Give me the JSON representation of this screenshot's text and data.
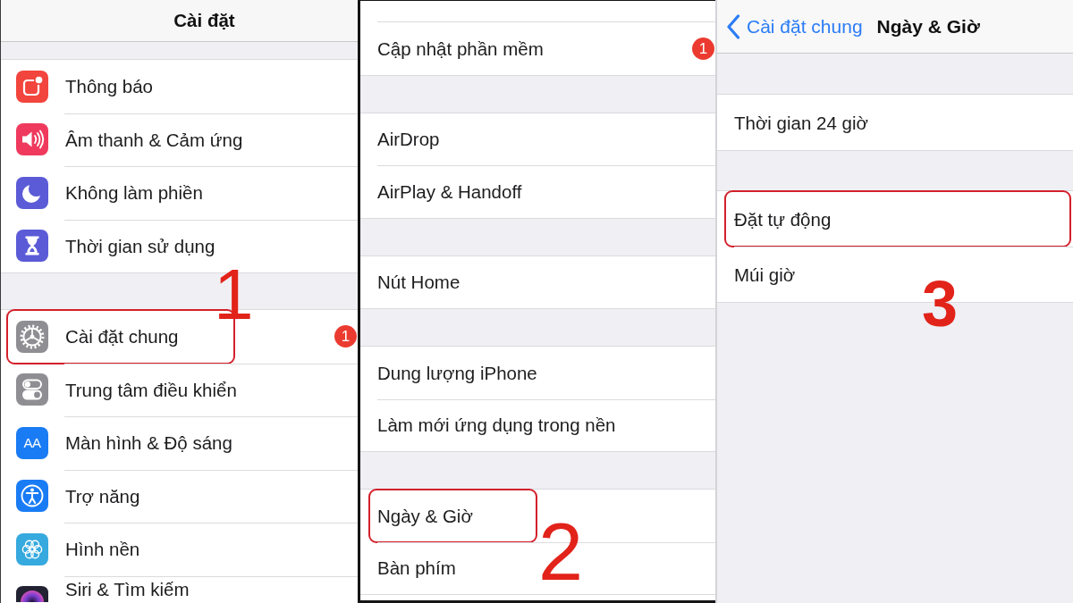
{
  "panels": [
    {
      "title": "Cài đặt",
      "groups": [
        {
          "items": [
            {
              "label": "Thông báo",
              "highlighted": false
            },
            {
              "label": "Âm thanh & Cảm ứng",
              "highlighted": false
            },
            {
              "label": "Không làm phiền",
              "highlighted": false
            },
            {
              "label": "Thời gian sử dụng",
              "highlighted": false
            }
          ]
        },
        {
          "items": [
            {
              "label": "Cài đặt chung",
              "highlighted": true,
              "badge": "1"
            },
            {
              "label": "Trung tâm điều khiển",
              "highlighted": false
            },
            {
              "label": "Màn hình & Độ sáng",
              "highlighted": false,
              "icon_text": "AA"
            },
            {
              "label": "Trợ năng",
              "highlighted": false
            },
            {
              "label": "Hình nền",
              "highlighted": false
            },
            {
              "label": "Siri & Tìm kiếm",
              "highlighted": false
            }
          ]
        }
      ],
      "step": "1"
    },
    {
      "groups": [
        {
          "items": [
            {
              "label": "Cập nhật phần mềm",
              "highlighted": false,
              "badge": "1"
            }
          ]
        },
        {
          "items": [
            {
              "label": "AirDrop",
              "highlighted": false
            },
            {
              "label": "AirPlay & Handoff",
              "highlighted": false
            }
          ]
        },
        {
          "items": [
            {
              "label": "Nút Home",
              "highlighted": false
            }
          ]
        },
        {
          "items": [
            {
              "label": "Dung lượng iPhone",
              "highlighted": false
            },
            {
              "label": "Làm mới ứng dụng trong nền",
              "highlighted": false
            }
          ]
        },
        {
          "items": [
            {
              "label": "Ngày & Giờ",
              "highlighted": true
            },
            {
              "label": "Bàn phím",
              "highlighted": false
            }
          ]
        }
      ],
      "step": "2"
    },
    {
      "back": "Cài đặt chung",
      "title": "Ngày & Giờ",
      "groups": [
        {
          "items": [
            {
              "label": "Thời gian 24 giờ",
              "highlighted": false
            }
          ]
        },
        {
          "items": [
            {
              "label": "Đặt tự động",
              "highlighted": true
            },
            {
              "label": "Múi giờ",
              "highlighted": false
            }
          ]
        }
      ],
      "step": "3"
    }
  ]
}
